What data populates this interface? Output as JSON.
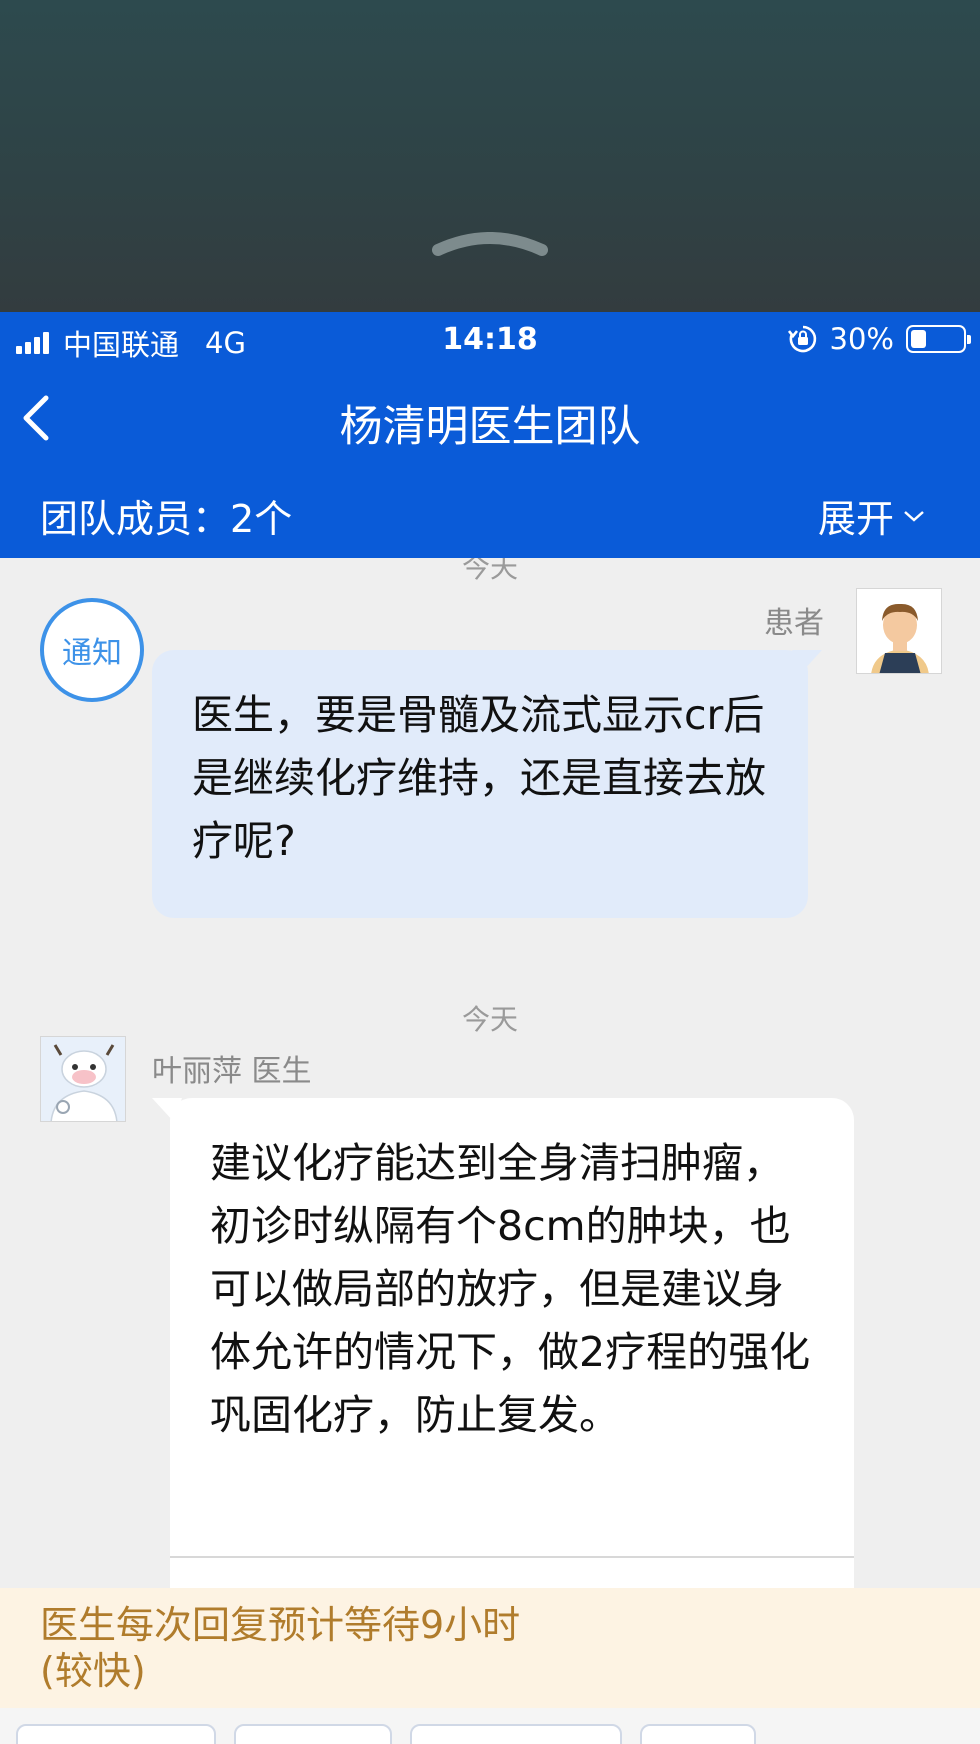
{
  "status_bar": {
    "carrier": "中国联通",
    "network": "4G",
    "time": "14:18",
    "battery": "30%",
    "battery_level": 0.3
  },
  "nav": {
    "title": "杨清明医生团队"
  },
  "team": {
    "members_label": "团队成员：",
    "members_count": "2个",
    "expand_label": "展开"
  },
  "chat": {
    "messages": [
      {
        "time_label": "今天",
        "sender": "患者",
        "badge": "通知",
        "text": "医生，要是骨髓及流式显示cr后是继续化疗维持，还是直接去放疗呢?"
      },
      {
        "time_label": "今天",
        "sender": "叶丽萍 医生",
        "text": "建议化疗能达到全身清扫肿瘤，初诊时纵隔有个8cm的肿块，也可以做局部的放疗，但是建议身体允许的情况下，做2疗程的强化巩固化疗，防止复发。"
      }
    ]
  },
  "wait_banner": {
    "line1": "医生每次回复预计等待9小时",
    "line2": "(较快)"
  },
  "colors": {
    "brand_blue": "#0a5bd8",
    "patient_bubble": "#e1ebfa",
    "notice_blue": "#3d92e8",
    "banner_bg": "#fdf3e3",
    "banner_text": "#b07c2c"
  }
}
